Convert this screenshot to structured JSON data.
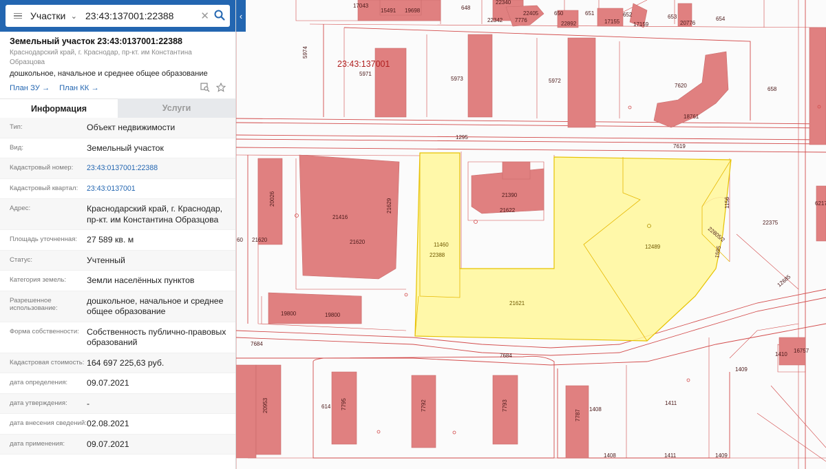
{
  "search": {
    "layer": "Участки",
    "query": "23:43:137001:22388"
  },
  "object": {
    "title": "Земельный участок 23:43:0137001:22388",
    "address_short": "Краснодарский край, г. Краснодар, пр-кт. им Константина Образцова",
    "use_short": "дошкольное, начальное и среднее общее образование",
    "link_zu": "План ЗУ",
    "link_kk": "План КК"
  },
  "tabs": [
    {
      "label": "Информация"
    },
    {
      "label": "Услуги"
    }
  ],
  "rows": [
    {
      "k": "Тип:",
      "v": "Объект недвижимости"
    },
    {
      "k": "Вид:",
      "v": "Земельный участок"
    },
    {
      "k": "Кадастровый номер:",
      "v": "23:43:0137001:22388"
    },
    {
      "k": "Кадастровый квартал:",
      "v": "23:43:0137001"
    },
    {
      "k": "Адрес:",
      "v": "Краснодарский край, г. Краснодар, пр-кт. им Константина Образцова"
    },
    {
      "k": "Площадь уточненная:",
      "v": "27 589 кв. м"
    },
    {
      "k": "Статус:",
      "v": "Учтенный"
    },
    {
      "k": "Категория земель:",
      "v": "Земли населённых пунктов"
    },
    {
      "k": "Разрешенное использование:",
      "v": "дошкольное, начальное и среднее общее образование"
    },
    {
      "k": "Форма собственности:",
      "v": "Собственность публично-правовых образований"
    },
    {
      "k": "Кадастровая стоимость:",
      "v": "164 697 225,63 руб."
    },
    {
      "k": "дата определения:",
      "v": "09.07.2021"
    },
    {
      "k": "дата утверждения:",
      "v": "-"
    },
    {
      "k": "дата внесения сведений:",
      "v": "02.08.2021"
    },
    {
      "k": "дата применения:",
      "v": "09.07.2021"
    }
  ],
  "map": {
    "quarter_label": "23:43:137001",
    "labels": {
      "l17043": "17043",
      "l15491": "15491",
      "l19698": "19698",
      "l648": "648",
      "l22340": "22340",
      "l22405": "22405",
      "l22342": "22342",
      "l7776": "7776",
      "l650": "650",
      "l22892": "22892",
      "l651": "651",
      "l17155": "17155",
      "l652": "652",
      "l17159": "17159",
      "l653": "653",
      "l20776": "20776",
      "l654": "654",
      "l5974": "5974",
      "l5971": "5971",
      "l5973": "5973",
      "l5972": "5972",
      "l7620": "7620",
      "l658": "658",
      "l18761": "18761",
      "l1295": "1295",
      "l7619": "7619",
      "l20026": "20026",
      "l21620a": "21620",
      "l21416": "21416",
      "l21620b": "21620",
      "l21629": "21629",
      "l21390": "21390",
      "l21622": "21622",
      "l11460": "11460",
      "l22388": "22388",
      "l12489": "12489",
      "l21621": "21621",
      "l1156": "1156",
      "l22805": "22805/2",
      "l22375": "22375",
      "l6217": "6217",
      "l19800a": "19800",
      "l19800b": "19800",
      "l7684a": "7684",
      "l7684b": "7684",
      "l60": "60",
      "l1409a": "1409",
      "l1410": "1410",
      "l16757": "16757",
      "l614": "614",
      "l7795": "7795",
      "l7792": "7792",
      "l7793": "7793",
      "l7787": "7787",
      "l1408a": "1408",
      "l1411a": "1411",
      "l1408b": "1408",
      "l1411b": "1411",
      "l1409b": "1409",
      "l20953": "20953",
      "l12685": "12685",
      "l1595": "1595"
    }
  }
}
